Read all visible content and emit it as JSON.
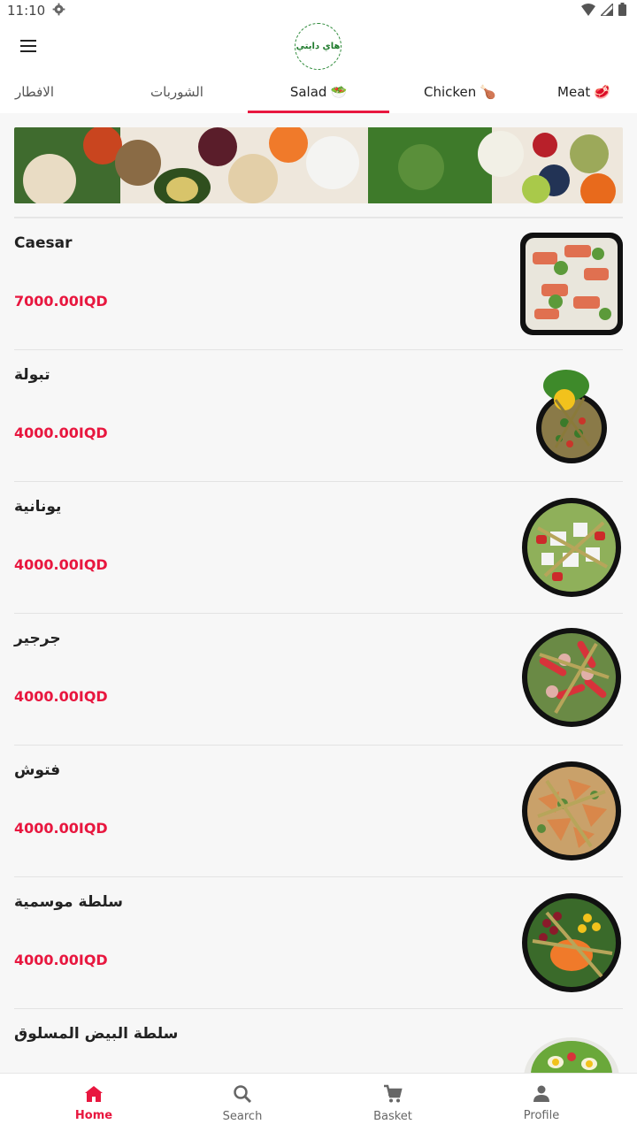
{
  "status_bar": {
    "time": "11:10"
  },
  "logo": {
    "text": "هاي دايتي"
  },
  "tabs": [
    {
      "label": "الافطار",
      "emoji": ""
    },
    {
      "label": "الشوربات",
      "emoji": ""
    },
    {
      "label": "Salad",
      "emoji": "🥗",
      "active": true
    },
    {
      "label": "Chicken",
      "emoji": "🍗"
    },
    {
      "label": "Meat",
      "emoji": "🥩"
    }
  ],
  "colors": {
    "accent": "#e8173f",
    "logo_green": "#2e8b3a"
  },
  "items": [
    {
      "name": "Caesar",
      "price": "7000.00IQD",
      "image": "caesar-salad"
    },
    {
      "name": "تبولة",
      "price": "4000.00IQD",
      "image": "tabbouleh"
    },
    {
      "name": "يونانية",
      "price": "4000.00IQD",
      "image": "greek-salad"
    },
    {
      "name": "جرجير",
      "price": "4000.00IQD",
      "image": "arugula-salad"
    },
    {
      "name": "فتوش",
      "price": "4000.00IQD",
      "image": "fattoush"
    },
    {
      "name": "سلطة موسمية",
      "price": "4000.00IQD",
      "image": "seasonal-salad"
    },
    {
      "name": "سلطة البيض المسلوق",
      "price": "",
      "image": "boiled-egg-salad"
    }
  ],
  "bottom_nav": [
    {
      "label": "Home",
      "icon": "home-icon",
      "active": true
    },
    {
      "label": "Search",
      "icon": "search-icon"
    },
    {
      "label": "Basket",
      "icon": "cart-icon"
    },
    {
      "label": "Profile",
      "icon": "person-icon"
    }
  ]
}
